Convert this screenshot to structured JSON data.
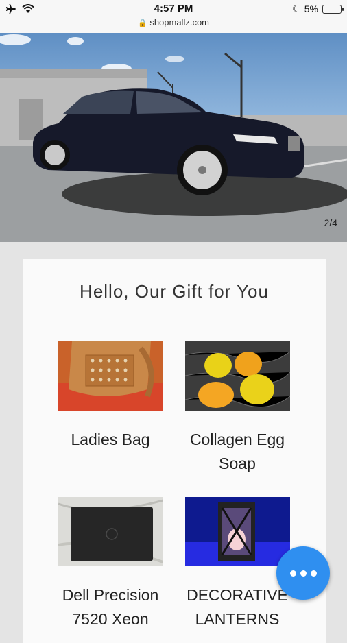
{
  "status": {
    "time": "4:57 PM",
    "url": "shopmallz.com",
    "battery": "5%",
    "battery_level": 0.05
  },
  "hero": {
    "pager": "2/4"
  },
  "section": {
    "title": "Hello, Our Gift for You"
  },
  "products": [
    {
      "name": "Ladies Bag"
    },
    {
      "name": "Collagen Egg Soap"
    },
    {
      "name": "Dell Precision 7520 Xeon"
    },
    {
      "name": "DECORATIVE LANTERNS"
    }
  ]
}
